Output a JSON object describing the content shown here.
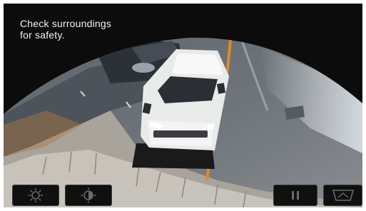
{
  "screen": {
    "message": "Check surroundings\nfor safety."
  },
  "controls": {
    "left": [
      {
        "icon": "brightness-icon",
        "label": "Brightness"
      },
      {
        "icon": "contrast-icon",
        "label": "Contrast"
      }
    ],
    "right": [
      {
        "icon": "pause-icon",
        "label": "Pause"
      },
      {
        "icon": "view-switch-icon",
        "label": "View"
      }
    ]
  },
  "colors": {
    "background": "#0c0c0c",
    "guide_line": "#e08a2c",
    "vehicle": "#f2f2f2",
    "text": "#f2f2f2"
  }
}
